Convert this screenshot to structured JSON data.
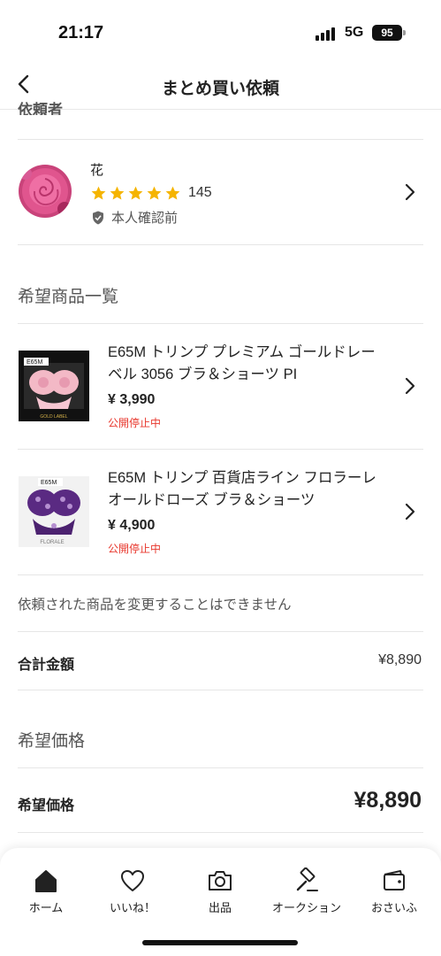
{
  "status_bar": {
    "time": "21:17",
    "network": "5G",
    "battery": "95"
  },
  "nav": {
    "title": "まとめ買い依頼"
  },
  "requester_section": {
    "title": "依頼者"
  },
  "requester": {
    "name": "花",
    "rating": 5,
    "rating_count": "145",
    "verification": "本人確認前"
  },
  "products_section": {
    "title": "希望商品一覧"
  },
  "products": [
    {
      "title": "E65M トリンプ プレミアム ゴールドレーベル 3056 ブラ＆ショーツ PI",
      "price": "¥ 3,990",
      "status": "公開停止中",
      "thumb_label": "E65M",
      "thumb_caption": "GOLD LABEL"
    },
    {
      "title": "E65M トリンプ 百貨店ライン フロラーレ オールドローズ ブラ＆ショーツ",
      "price": "¥ 4,900",
      "status": "公開停止中",
      "thumb_label": "E65M",
      "thumb_caption": "FLORALE"
    }
  ],
  "note": "依頼された商品を変更することはできません",
  "total": {
    "label": "合計金額",
    "value": "¥8,890"
  },
  "desired_section": {
    "title": "希望価格"
  },
  "desired": {
    "label": "希望価格",
    "value": "¥8,890"
  },
  "tabbar": {
    "items": [
      {
        "label": "ホーム",
        "icon": "home-icon"
      },
      {
        "label": "いいね！",
        "icon": "heart-icon"
      },
      {
        "label": "出品",
        "icon": "camera-icon"
      },
      {
        "label": "オークション",
        "icon": "gavel-icon"
      },
      {
        "label": "おさいふ",
        "icon": "wallet-icon"
      }
    ]
  },
  "colors": {
    "star": "#f5b400",
    "alert": "#e8372d",
    "text": "#222222"
  }
}
